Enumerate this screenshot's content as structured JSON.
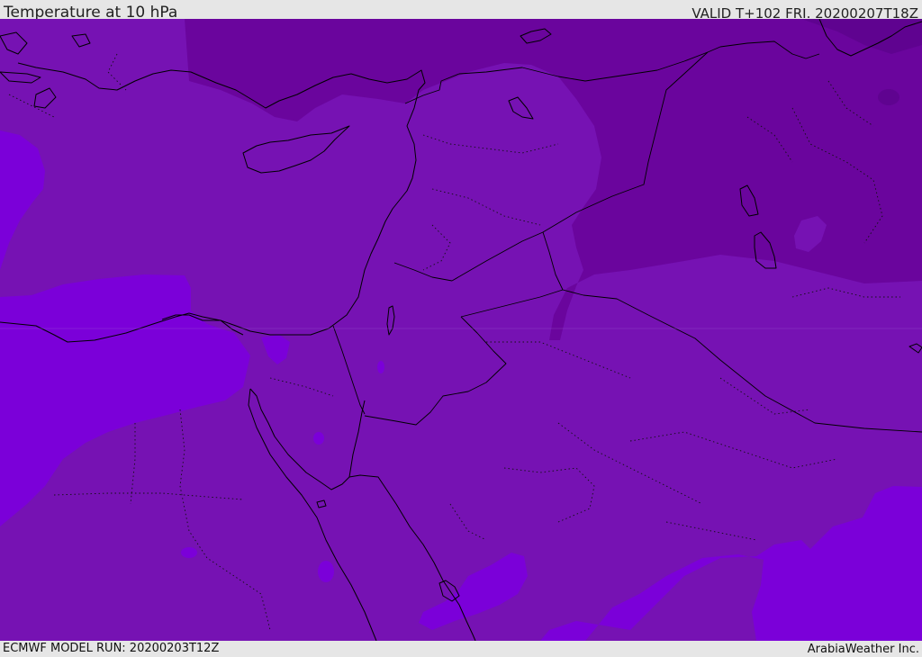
{
  "header": {
    "title": "Temperature at 10 hPa",
    "valid": "VALID T+102 FRI. 20200207T18Z"
  },
  "footer": {
    "model_run": "ECMWF MODEL RUN: 20200203T12Z",
    "credit": "ArabiaWeather Inc."
  },
  "colors": {
    "band_base": "#7612b3",
    "band_cold": "#6a059d",
    "band_colder": "#5f0390",
    "band_warm": "#7b00d9",
    "land_outline": "#000000",
    "bar_background": "#e6e6e6"
  }
}
